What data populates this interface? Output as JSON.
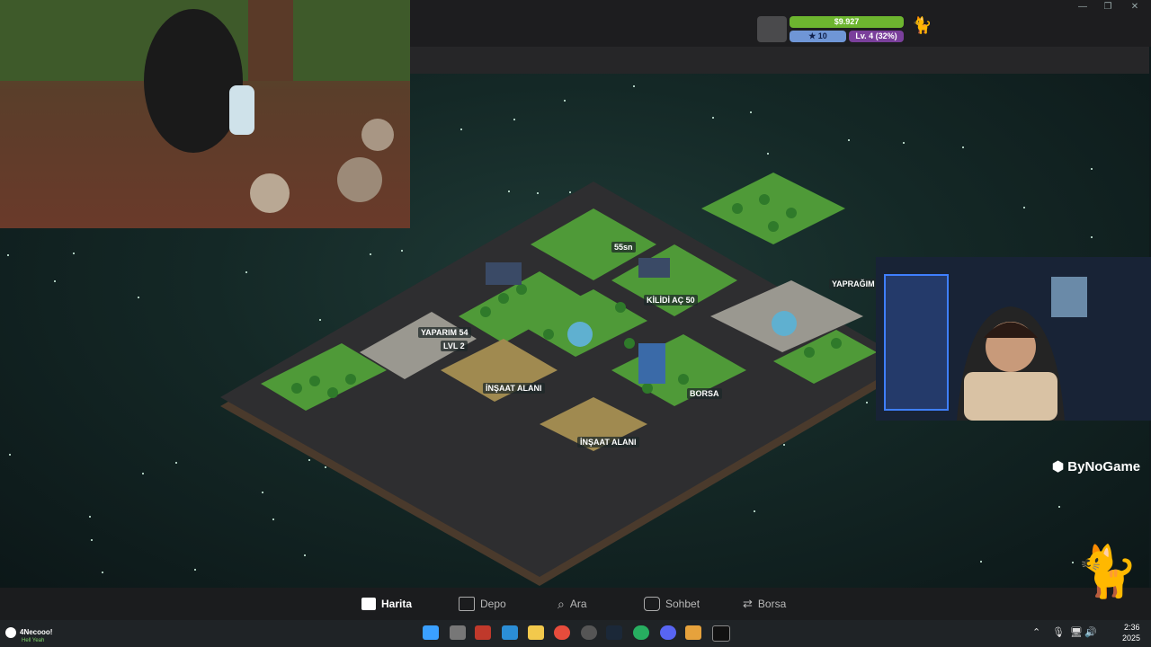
{
  "window": {
    "minimize": "—",
    "restore": "❐",
    "close": "✕"
  },
  "hud": {
    "money": "$9.927",
    "stars": "10",
    "level": "Lv. 4 (32%)"
  },
  "map_labels": {
    "timer": "55sn",
    "unlock": "KİLİDİ AÇ 50",
    "yaparim": "YAPARIM 54",
    "lvl": "LVL 2",
    "construction1": "İNŞAAT ALANI",
    "construction2": "İNŞAAT ALANI",
    "borsa": "BORSA",
    "yapragim": "YAPRAĞIM H"
  },
  "brand": "ByNoGame",
  "nav": [
    {
      "label": "Harita",
      "icon": "map-icon",
      "active": true
    },
    {
      "label": "Depo",
      "icon": "warehouse-icon",
      "active": false
    },
    {
      "label": "Ara",
      "icon": "search-icon",
      "active": false
    },
    {
      "label": "Sohbet",
      "icon": "chat-icon",
      "active": false
    },
    {
      "label": "Borsa",
      "icon": "exchange-icon",
      "active": false
    }
  ],
  "taskbar": {
    "user": "4Necooo!",
    "user_status": "Hell Yeah",
    "time": "2:36",
    "date": "2025"
  }
}
